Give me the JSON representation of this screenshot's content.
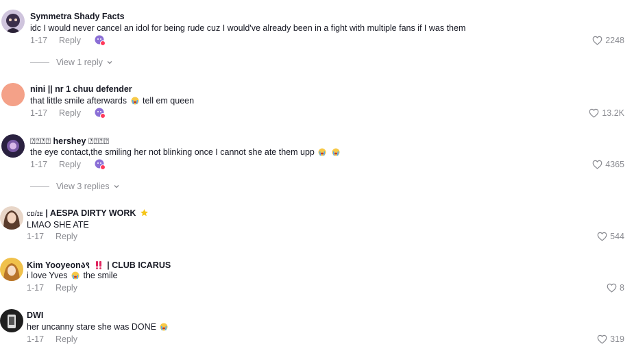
{
  "comments": [
    {
      "author": "Symmetra Shady Facts",
      "text": "idc I would never cancel an idol for being rude cuz I would've already been in a fight with multiple fans if I was them",
      "date": "1-17",
      "reply_label": "Reply",
      "likes": "2248",
      "view_replies": "View 1 reply",
      "avatar_color": "#3b2f4a"
    },
    {
      "author": "nini || nr 1 chuu defender",
      "text_before": "that little smile afterwards",
      "text_after": "tell em queen",
      "date": "1-17",
      "reply_label": "Reply",
      "likes": "13.2K",
      "avatar_color": "#f4a188"
    },
    {
      "author_prefix": "⍰⍰⍰⍰",
      "author_main": "hershey",
      "author_suffix": "⍰⍰⍰⍰",
      "text": "the eye contact,the smiling her not blinking once I cannot she ate them upp",
      "date": "1-17",
      "reply_label": "Reply",
      "likes": "4365",
      "view_replies": "View 3 replies",
      "avatar_color": "#2a2140"
    },
    {
      "author_prefix": "ᴄᴅ/ɪᴇ",
      "author_main": "| AESPA DIRTY WORK",
      "text": "LMAO SHE ATE",
      "date": "1-17",
      "reply_label": "Reply",
      "likes": "544",
      "avatar_color": "#c9a88c"
    },
    {
      "author": "Kim Yooyeonა९",
      "author_suffix": "| CLUB ICARUS",
      "text_before": "i love Yves",
      "text_after": "the smile",
      "date": "1-17",
      "reply_label": "Reply",
      "likes": "8",
      "avatar_color": "#d9a23a"
    },
    {
      "author": "DWI",
      "text": "her uncanny stare she was DONE",
      "date": "1-17",
      "reply_label": "Reply",
      "likes": "319",
      "avatar_color": "#222222"
    }
  ],
  "icons": {
    "like": "heart-outline-icon",
    "reaction": "emoji-reaction-icon",
    "chevron": "chevron-down-icon",
    "star": "star-icon",
    "double_exclamation": "double-exclamation-icon",
    "crying_emoji": "loudly-crying-face-icon"
  },
  "colors": {
    "text": "#161823",
    "muted": "#8a8b91",
    "reaction_purple": "#8b6fd6",
    "reaction_red": "#ff3b5c"
  }
}
